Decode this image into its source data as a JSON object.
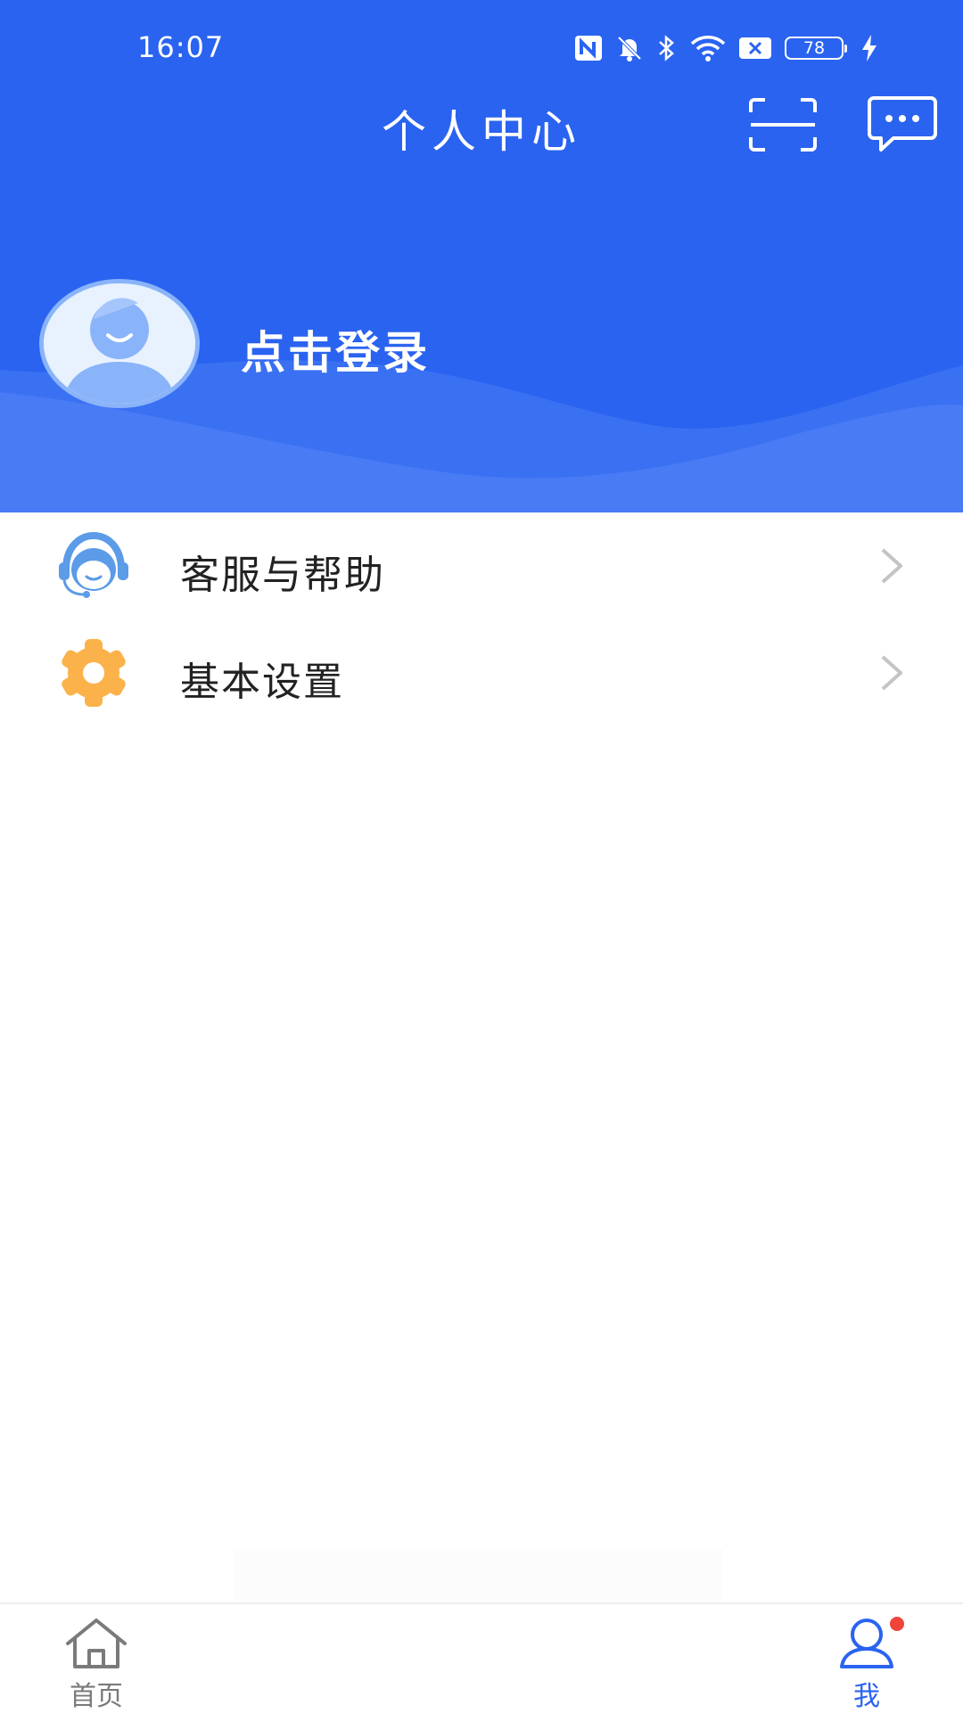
{
  "status_bar": {
    "time": "16:07",
    "battery": "78",
    "icons": [
      "nfc-icon",
      "mute-icon",
      "bluetooth-icon",
      "wifi-icon",
      "no-sim-icon",
      "battery-icon",
      "charging-icon"
    ]
  },
  "header": {
    "title": "个人中心",
    "scan_icon": "scan-icon",
    "message_icon": "message-icon"
  },
  "profile": {
    "login_label": "点击登录",
    "avatar_icon": "avatar-icon"
  },
  "menu": {
    "items": [
      {
        "label": "客服与帮助",
        "icon": "customer-service-icon"
      },
      {
        "label": "基本设置",
        "icon": "settings-gear-icon"
      }
    ]
  },
  "bottom_nav": {
    "items": [
      {
        "label": "首页",
        "icon": "home-icon",
        "active": false
      },
      {
        "label": "我",
        "icon": "user-icon",
        "active": true
      }
    ]
  },
  "colors": {
    "primary": "#2a63f0",
    "accent_gear": "#fbb24a",
    "badge": "#f0443a",
    "text_dark": "#222222",
    "text_muted": "#7a7a7a"
  }
}
